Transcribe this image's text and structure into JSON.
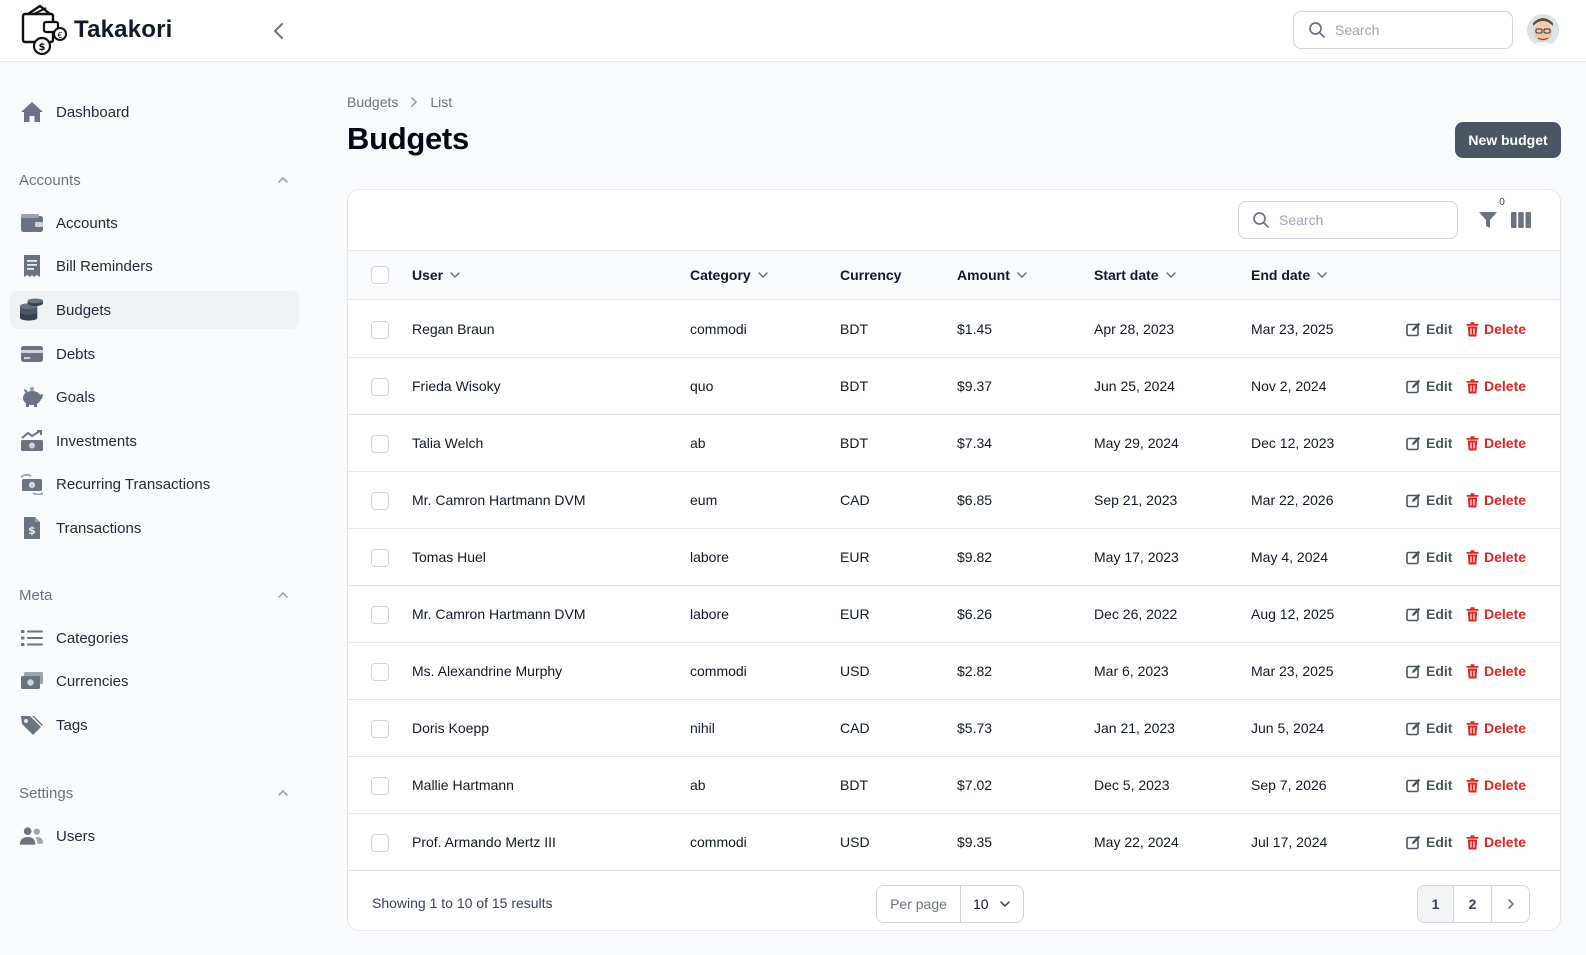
{
  "app": {
    "name": "Takakori"
  },
  "header": {
    "search_placeholder": "Search"
  },
  "sidebar": {
    "dashboard": "Dashboard",
    "groups": [
      {
        "label": "Accounts",
        "items": [
          "Accounts",
          "Bill Reminders",
          "Budgets",
          "Debts",
          "Goals",
          "Investments",
          "Recurring Transactions",
          "Transactions"
        ]
      },
      {
        "label": "Meta",
        "items": [
          "Categories",
          "Currencies",
          "Tags"
        ]
      },
      {
        "label": "Settings",
        "items": [
          "Users"
        ]
      }
    ],
    "active": "Budgets"
  },
  "breadcrumb": [
    "Budgets",
    "List"
  ],
  "page": {
    "title": "Budgets",
    "new_button": "New budget"
  },
  "table": {
    "search_placeholder": "Search",
    "filter_count": "0",
    "columns": [
      "User",
      "Category",
      "Currency",
      "Amount",
      "Start date",
      "End date"
    ],
    "edit_label": "Edit",
    "delete_label": "Delete",
    "rows": [
      {
        "user": "Regan Braun",
        "category": "commodi",
        "currency": "BDT",
        "amount": "$1.45",
        "start": "Apr 28, 2023",
        "end": "Mar 23, 2025"
      },
      {
        "user": "Frieda Wisoky",
        "category": "quo",
        "currency": "BDT",
        "amount": "$9.37",
        "start": "Jun 25, 2024",
        "end": "Nov 2, 2024"
      },
      {
        "user": "Talia Welch",
        "category": "ab",
        "currency": "BDT",
        "amount": "$7.34",
        "start": "May 29, 2024",
        "end": "Dec 12, 2023"
      },
      {
        "user": "Mr. Camron Hartmann DVM",
        "category": "eum",
        "currency": "CAD",
        "amount": "$6.85",
        "start": "Sep 21, 2023",
        "end": "Mar 22, 2026"
      },
      {
        "user": "Tomas Huel",
        "category": "labore",
        "currency": "EUR",
        "amount": "$9.82",
        "start": "May 17, 2023",
        "end": "May 4, 2024"
      },
      {
        "user": "Mr. Camron Hartmann DVM",
        "category": "labore",
        "currency": "EUR",
        "amount": "$6.26",
        "start": "Dec 26, 2022",
        "end": "Aug 12, 2025"
      },
      {
        "user": "Ms. Alexandrine Murphy",
        "category": "commodi",
        "currency": "USD",
        "amount": "$2.82",
        "start": "Mar 6, 2023",
        "end": "Mar 23, 2025"
      },
      {
        "user": "Doris Koepp",
        "category": "nihil",
        "currency": "CAD",
        "amount": "$5.73",
        "start": "Jan 21, 2023",
        "end": "Jun 5, 2024"
      },
      {
        "user": "Mallie Hartmann",
        "category": "ab",
        "currency": "BDT",
        "amount": "$7.02",
        "start": "Dec 5, 2023",
        "end": "Sep 7, 2026"
      },
      {
        "user": "Prof. Armando Mertz III",
        "category": "commodi",
        "currency": "USD",
        "amount": "$9.35",
        "start": "May 22, 2024",
        "end": "Jul 17, 2024"
      }
    ]
  },
  "footer": {
    "showing": "Showing 1 to 10 of 15 results",
    "per_page_label": "Per page",
    "per_page_value": "10",
    "pages": [
      "1",
      "2"
    ]
  },
  "colors": {
    "primary_button": "#4b5563",
    "delete": "#dc2626",
    "active_nav_bg": "#f0f1f3"
  }
}
